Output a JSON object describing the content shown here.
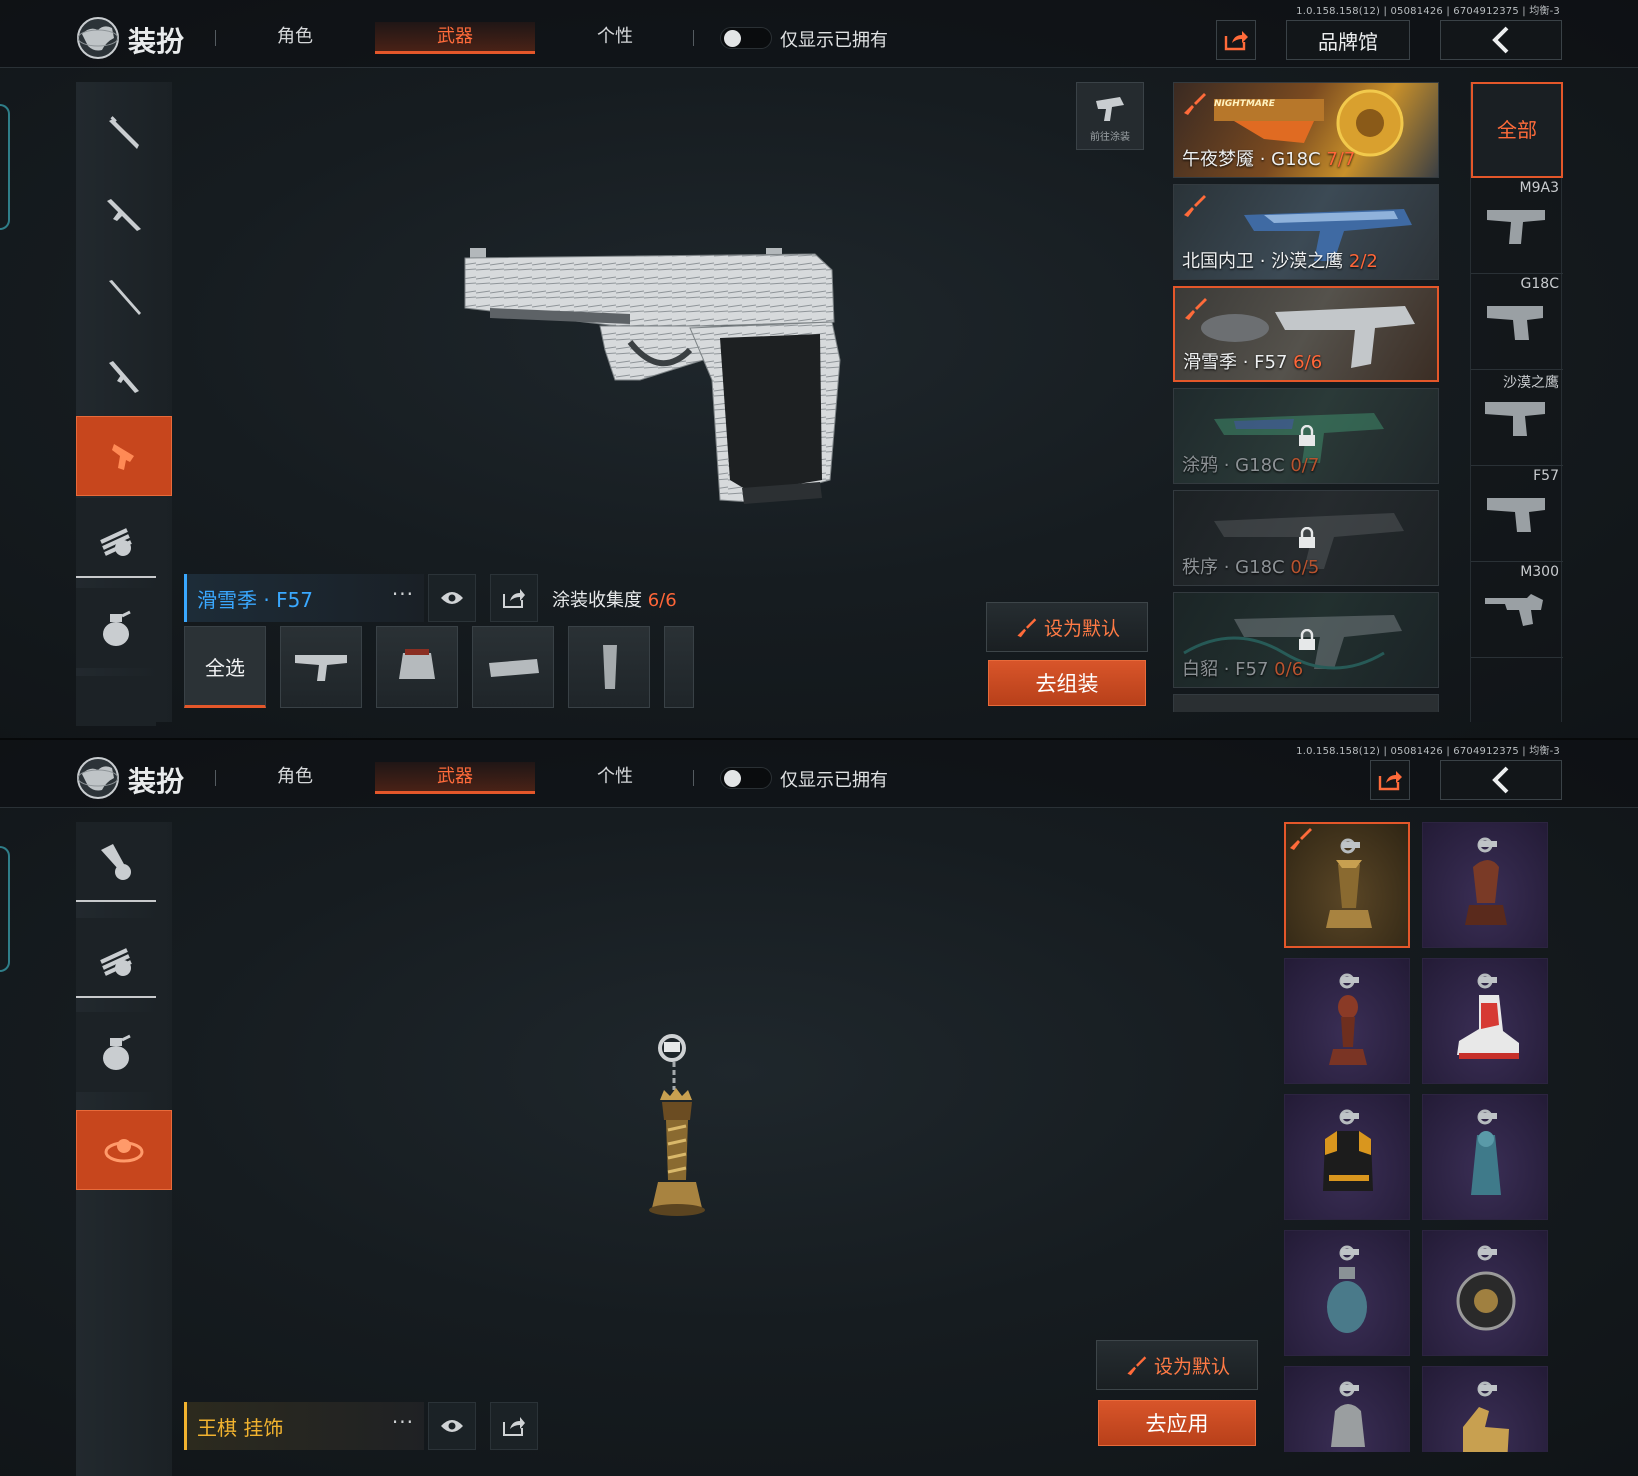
{
  "app": {
    "title": "装扮",
    "version": "1.0.158.158(12) | 05081426 | 6704912375 | 均衡-3"
  },
  "tabs": [
    {
      "label": "角色"
    },
    {
      "label": "武器"
    },
    {
      "label": "个性"
    }
  ],
  "active_tab": "武器",
  "filter_owned": {
    "label": "仅显示已拥有",
    "enabled": false
  },
  "brand_hall_label": "品牌馆",
  "goto_skin_label": "前往涂装",
  "top": {
    "skins": [
      {
        "name": "午夜梦魇 · G18C",
        "count": "7/7",
        "owned": true,
        "banner_text": "NIGHTMARE",
        "selected": false
      },
      {
        "name": "北国内卫 · 沙漠之鹰",
        "count": "2/2",
        "owned": true,
        "selected": false
      },
      {
        "name": "滑雪季 · F57",
        "count": "6/6",
        "owned": true,
        "selected": true
      },
      {
        "name": "涂鸦 · G18C",
        "count": "0/7",
        "owned": false,
        "selected": false
      },
      {
        "name": "秩序 · G18C",
        "count": "0/5",
        "owned": false,
        "selected": false
      },
      {
        "name": "白貂 · F57",
        "count": "0/6",
        "owned": false,
        "selected": false
      }
    ],
    "weapon_filters": {
      "all_label": "全部",
      "items": [
        {
          "label": "M9A3"
        },
        {
          "label": "G18C"
        },
        {
          "label": "沙漠之鹰"
        },
        {
          "label": "F57"
        },
        {
          "label": "M300"
        }
      ]
    },
    "selected_skin": {
      "name": "滑雪季 · F57",
      "more": "···"
    },
    "collection": {
      "label": "涂装收集度",
      "value": "6/6"
    },
    "select_all_label": "全选",
    "set_default_label": "设为默认",
    "action_label": "去组装"
  },
  "bottom": {
    "selected_item": {
      "name": "王棋 挂饰",
      "more": "···"
    },
    "set_default_label": "设为默认",
    "action_label": "去应用",
    "pendants": [
      {
        "icon": "king-chess-pendant-icon",
        "equipped": true
      },
      {
        "icon": "horse-chess-pendant-icon"
      },
      {
        "icon": "bishop-chess-pendant-icon"
      },
      {
        "icon": "sneaker-pendant-icon"
      },
      {
        "icon": "vest-pendant-icon"
      },
      {
        "icon": "statue-pendant-icon"
      },
      {
        "icon": "grenade-pendant-icon"
      },
      {
        "icon": "medal-pendant-icon"
      },
      {
        "icon": "bell-pendant-icon"
      },
      {
        "icon": "thumbs-up-pendant-icon"
      }
    ]
  },
  "colors": {
    "accent": "#e4572a",
    "accent_text": "#ff6b3a",
    "name_blue": "#3aa8ff",
    "name_gold": "#f2b32f"
  }
}
